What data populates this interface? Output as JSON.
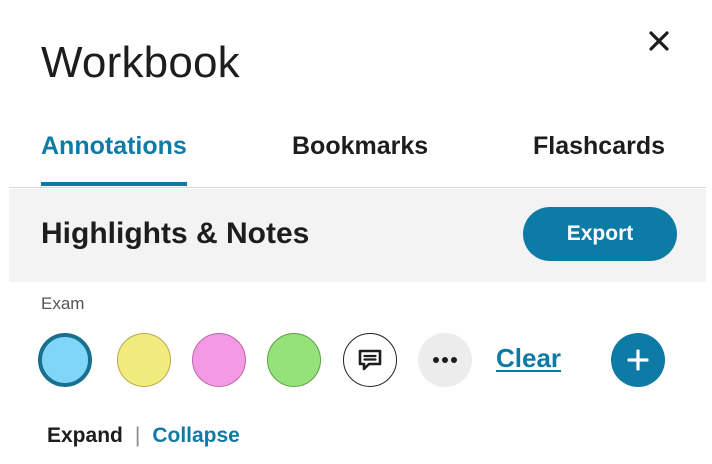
{
  "panel": {
    "title": "Workbook",
    "close_icon": "close-icon"
  },
  "tabs": [
    {
      "label": "Annotations",
      "active": true
    },
    {
      "label": "Bookmarks",
      "active": false
    },
    {
      "label": "Flashcards",
      "active": false
    }
  ],
  "section": {
    "title": "Highlights & Notes",
    "export_label": "Export"
  },
  "filters": {
    "label": "Exam",
    "swatches": [
      {
        "name": "blue",
        "color": "#7fd6f7",
        "selected": true
      },
      {
        "name": "yellow",
        "color": "#f1ea7c",
        "selected": false
      },
      {
        "name": "pink",
        "color": "#f49ae4",
        "selected": false
      },
      {
        "name": "green",
        "color": "#95e27a",
        "selected": false
      }
    ],
    "note_icon": "note-comment-icon",
    "more_icon": "more-horizontal-icon",
    "clear_label": "Clear",
    "add_icon": "plus-icon"
  },
  "view_controls": {
    "expand_label": "Expand",
    "separator": "|",
    "collapse_label": "Collapse"
  },
  "colors": {
    "accent": "#0e7ba6",
    "section_bg": "#f3f3f3"
  }
}
